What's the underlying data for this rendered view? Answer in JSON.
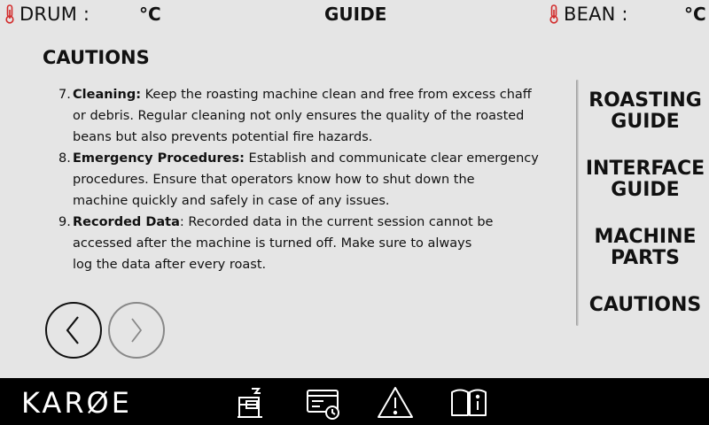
{
  "header": {
    "drum_label": "DRUM :",
    "drum_unit": "°C",
    "page_title": "GUIDE",
    "bean_label": "BEAN :",
    "bean_unit": "°C"
  },
  "section_title": "CAUTIONS",
  "items": [
    {
      "number": "7.",
      "bold": "Cleaning:",
      "line1": "Keep the roasting machine clean and free from excess chaff",
      "line2": "or debris. Regular cleaning not only ensures the quality of the roasted",
      "line3": "beans but also prevents potential fire hazards."
    },
    {
      "number": "8.",
      "bold": "Emergency Procedures:",
      "line1": "Establish and communicate clear emergency",
      "line2": "procedures. Ensure that operators know how to shut down the",
      "line3": "machine quickly and safely in case of any issues."
    },
    {
      "number": "9.",
      "bold": "Recorded Data",
      "line1": ": Recorded data in the current session cannot be",
      "line2": "accessed after the machine is turned off. Make sure to always",
      "line3": "log the data after every roast."
    }
  ],
  "nav": {
    "roasting_l1": "ROASTING",
    "roasting_l2": "GUIDE",
    "interface_l1": "INTERFACE",
    "interface_l2": "GUIDE",
    "machine_l1": "MACHINE",
    "machine_l2": "PARTS",
    "cautions": "CAUTIONS"
  },
  "footer": {
    "logo": "KARØE"
  },
  "colors": {
    "thermometer": "#d22b2b",
    "background": "#e5e5e5",
    "bottom_bar": "#000000"
  }
}
